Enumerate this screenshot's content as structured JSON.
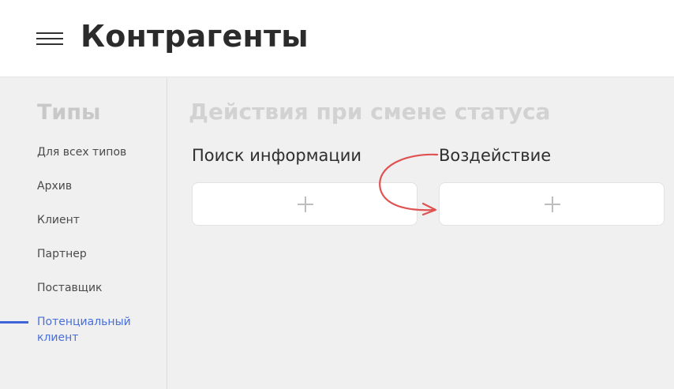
{
  "header": {
    "title": "Контрагенты",
    "menu_icon": "hamburger-icon"
  },
  "sidebar": {
    "title": "Типы",
    "items": [
      {
        "label": "Для всех типов",
        "active": false
      },
      {
        "label": "Архив",
        "active": false
      },
      {
        "label": "Клиент",
        "active": false
      },
      {
        "label": "Партнер",
        "active": false
      },
      {
        "label": "Поставщик",
        "active": false
      },
      {
        "label": "Потенциальный клиент",
        "active": true
      }
    ],
    "active_color": "#3f63d9"
  },
  "main": {
    "title": "Действия при смене статуса",
    "columns": [
      {
        "title": "Поиск информации",
        "add_icon": "plus-icon"
      },
      {
        "title": "Воздействие",
        "add_icon": "plus-icon"
      }
    ]
  },
  "annotation": {
    "arrow_color": "#e05252"
  }
}
